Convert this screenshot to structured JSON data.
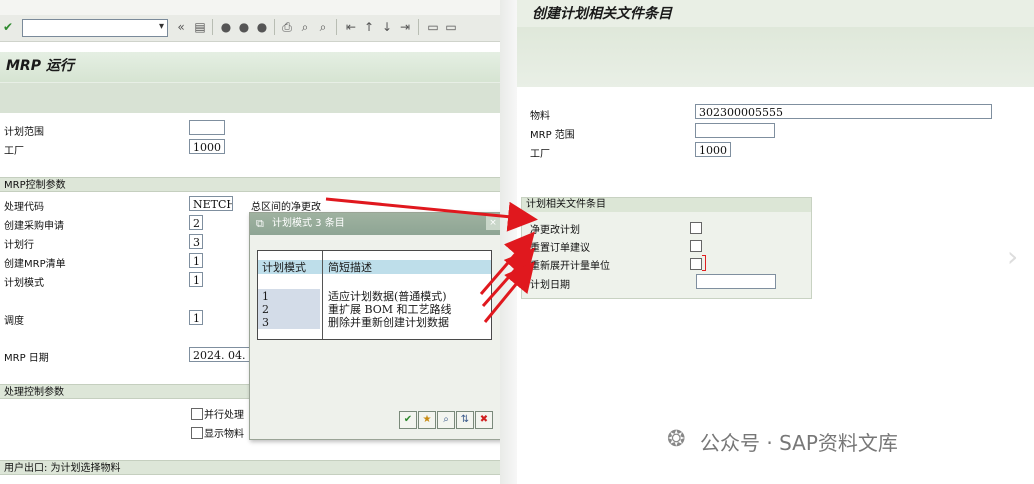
{
  "left": {
    "title": "MRP 运行",
    "fields": {
      "plan_scope": {
        "label": "计划范围",
        "value": ""
      },
      "plant": {
        "label": "工厂",
        "value": "1000"
      }
    },
    "section_mrp": "MRP控制参数",
    "params": {
      "processing_key": {
        "label": "处理代码",
        "value": "NETCH",
        "desc": "总区间的净更改"
      },
      "create_pr": {
        "label": "创建采购申请",
        "value": "2"
      },
      "schedule_lines": {
        "label": "计划行",
        "value": "3"
      },
      "mrp_list": {
        "label": "创建MRP清单",
        "value": "1"
      },
      "plan_mode": {
        "label": "计划模式",
        "value": "1"
      },
      "scheduling": {
        "label": "调度",
        "value": "1"
      },
      "mrp_date": {
        "label": "MRP 日期",
        "value": "2024. 04."
      }
    },
    "section_proc": "处理控制参数",
    "checkboxes": {
      "parallel": "并行处理",
      "display": "显示物料"
    },
    "section_user": "用户出口: 为计划选择物料"
  },
  "popup": {
    "title": "计划模式 3 条目",
    "headers": [
      "计划模式",
      "简短描述"
    ],
    "rows": [
      {
        "key": "1",
        "desc": "适应计划数据(普通模式)"
      },
      {
        "key": "2",
        "desc": "重扩展 BOM 和工艺路线"
      },
      {
        "key": "3",
        "desc": "删除并重新创建计划数据"
      }
    ]
  },
  "right": {
    "title": "创建计划相关文件条目",
    "fields": {
      "material": {
        "label": "物料",
        "value": "302300005555"
      },
      "mrp_area": {
        "label": "MRP 范围",
        "value": ""
      },
      "plant": {
        "label": "工厂",
        "value": "1000"
      }
    },
    "group": {
      "title": "计划相关文件条目",
      "net_change": "净更改计划",
      "reset_proposals": "重置订单建议",
      "reexplode": "重新展开计量单位",
      "plan_date": "计划日期"
    }
  },
  "watermark": "公众号 · SAP资料文库",
  "colors": {
    "arrow": "#e0181e",
    "header_green": "#d6e4d2",
    "popup_title": "#9fb2a0"
  }
}
